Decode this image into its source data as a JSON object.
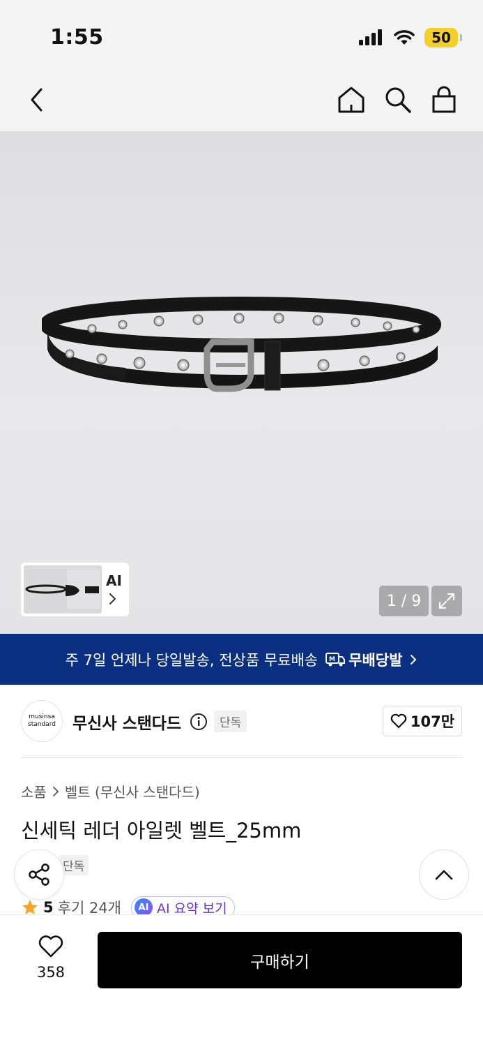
{
  "status_bar": {
    "time": "1:55",
    "battery": "50"
  },
  "gallery": {
    "thumb_ai_label": "AI",
    "counter": "1 / 9"
  },
  "promo": {
    "text": "주 7일 언제나 당일발송, 전상품 무료배송",
    "brand_label": "무배당발"
  },
  "brand": {
    "logo_line1": "musinsa",
    "logo_line2": "standard",
    "name": "무신사 스탠다드",
    "tag": "단독",
    "likes": "107만"
  },
  "product": {
    "breadcrumb": [
      "소품",
      "벨트 (무신사 스탠다드)"
    ],
    "title": "신세틱 레더 아일렛 벨트_25mm",
    "tag": "단독",
    "rating": "5",
    "reviews": "후기 24개",
    "ai_badge": "AI",
    "ai_summary": "AI 요약 보기"
  },
  "bottom_bar": {
    "wish_count": "358",
    "buy_label": "구매하기"
  },
  "colors": {
    "promo_bg": "#0a2e80",
    "battery": "#f5cf2a",
    "ai_purple": "#6a35d9",
    "star": "#f5a623"
  }
}
